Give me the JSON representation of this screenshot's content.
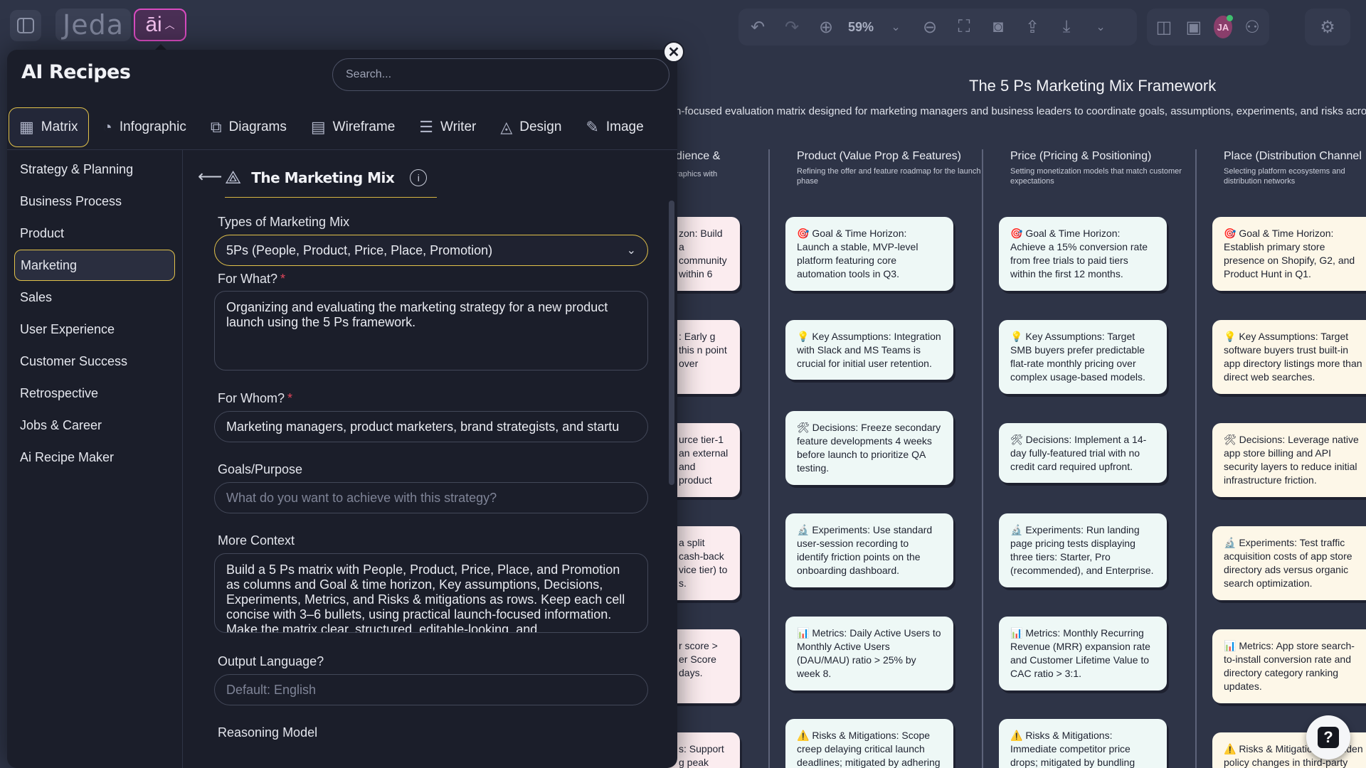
{
  "topbar": {
    "brand": "Jeda",
    "ai_label": "āi",
    "zoom": "59%",
    "avatar_initials": "JA"
  },
  "board": {
    "title": "The 5 Ps Marketing Mix Framework",
    "subtitle": "h-focused evaluation matrix designed for marketing managers and business leaders to coordinate goals, assumptions, experiments, and risks acro",
    "columns": [
      {
        "heading": "dience &",
        "sub": "raphics with"
      },
      {
        "heading": "Product (Value Prop & Features)",
        "sub": "Refining the offer and feature roadmap for the launch phase"
      },
      {
        "heading": "Price (Pricing & Positioning)",
        "sub": "Setting monetization models that match customer expectations"
      },
      {
        "heading": "Place (Distribution Channel",
        "sub": "Selecting platform ecosystems and distribution networks"
      }
    ],
    "cards": {
      "people": [
        "zon: Build a community within 6",
        ": Early g this n point over",
        "urce tier-1 an external and product",
        "a split cash-back vice tier) to s.",
        "r score > er Score days.",
        "s: Support g peak"
      ],
      "product": [
        "🎯 Goal & Time Horizon: Launch a stable, MVP-level platform featuring core automation tools in Q3.",
        "💡 Key Assumptions: Integration with Slack and MS Teams is crucial for initial user retention.",
        "🛠 Decisions: Freeze secondary feature developments 4 weeks before launch to prioritize QA testing.",
        "🔬 Experiments: Use standard user-session recording to identify friction points on the onboarding dashboard.",
        "📊 Metrics: Daily Active Users to Monthly Active Users (DAU/MAU) ratio > 25% by week 8.",
        "⚠️ Risks & Mitigations: Scope creep delaying critical launch deadlines; mitigated by adhering"
      ],
      "price": [
        "🎯 Goal & Time Horizon: Achieve a 15% conversion rate from free trials to paid tiers within the first 12 months.",
        "💡 Key Assumptions: Target SMB buyers prefer predictable flat-rate monthly pricing over complex usage-based models.",
        "🛠 Decisions: Implement a 14-day fully-featured trial with no credit card required upfront.",
        "🔬 Experiments: Run landing page pricing tests displaying three tiers: Starter, Pro (recommended), and Enterprise.",
        "📊 Metrics: Monthly Recurring Revenue (MRR) expansion rate and Customer Lifetime Value to CAC ratio > 3:1.",
        "⚠️ Risks & Mitigations: Immediate competitor price drops; mitigated by bundling"
      ],
      "place": [
        "🎯 Goal & Time Horizon: Establish primary store presence on Shopify, G2, and Product Hunt in Q1.",
        "💡 Key Assumptions: Target software buyers trust built-in app directory listings more than direct web searches.",
        "🛠 Decisions: Leverage native app store billing and API security layers to reduce initial infrastructure friction.",
        "🔬 Experiments: Test traffic acquisition costs of app store directory ads versus organic search optimization.",
        "📊 Metrics: App store search-to-install conversion rate and directory category ranking updates.",
        "⚠️ Risks & Mitigations: Sudden policy changes in third-party"
      ]
    }
  },
  "panel": {
    "title": "AI Recipes",
    "search_placeholder": "Search...",
    "close": "✕",
    "tabs": [
      {
        "label": "Matrix",
        "icon": "matrix-icon",
        "glyph": "▦"
      },
      {
        "label": "Infographic",
        "icon": "infographic-icon",
        "glyph": "◔"
      },
      {
        "label": "Diagrams",
        "icon": "diagrams-icon",
        "glyph": "⧉"
      },
      {
        "label": "Wireframe",
        "icon": "wireframe-icon",
        "glyph": "▤"
      },
      {
        "label": "Writer",
        "icon": "writer-icon",
        "glyph": "☰"
      },
      {
        "label": "Design",
        "icon": "design-icon",
        "glyph": "◬"
      },
      {
        "label": "Image",
        "icon": "image-icon",
        "glyph": "✎"
      }
    ],
    "categories": [
      "Strategy & Planning",
      "Business Process",
      "Product",
      "Marketing",
      "Sales",
      "User Experience",
      "Customer Success",
      "Retrospective",
      "Jobs & Career",
      "Ai Recipe Maker"
    ],
    "recipe": {
      "name": "The Marketing Mix",
      "type_label": "Types of Marketing Mix",
      "type_value": "5Ps (People, Product, Price, Place, Promotion)",
      "for_what_label": "For What?",
      "for_what_value": "Organizing and evaluating the marketing strategy for a new product launch using the 5 Ps framework.",
      "for_whom_label": "For Whom?",
      "for_whom_value": "Marketing managers, product marketers, brand strategists, and startu",
      "goals_label": "Goals/Purpose",
      "goals_placeholder": "What do you want to achieve with this strategy?",
      "context_label": "More Context",
      "context_value": "Build a 5 Ps matrix with People, Product, Price, Place, and Promotion as columns and Goal & time horizon, Key assumptions, Decisions, Experiments, Metrics, and Risks & mitigations as rows. Keep each cell concise with 3–6 bullets, using practical launch-focused information. Make the matrix clear, structured, editable-looking, and",
      "language_label": "Output Language?",
      "language_placeholder": "Default: English",
      "reasoning_label": "Reasoning Model",
      "required_mark": "*"
    }
  },
  "help": "?"
}
